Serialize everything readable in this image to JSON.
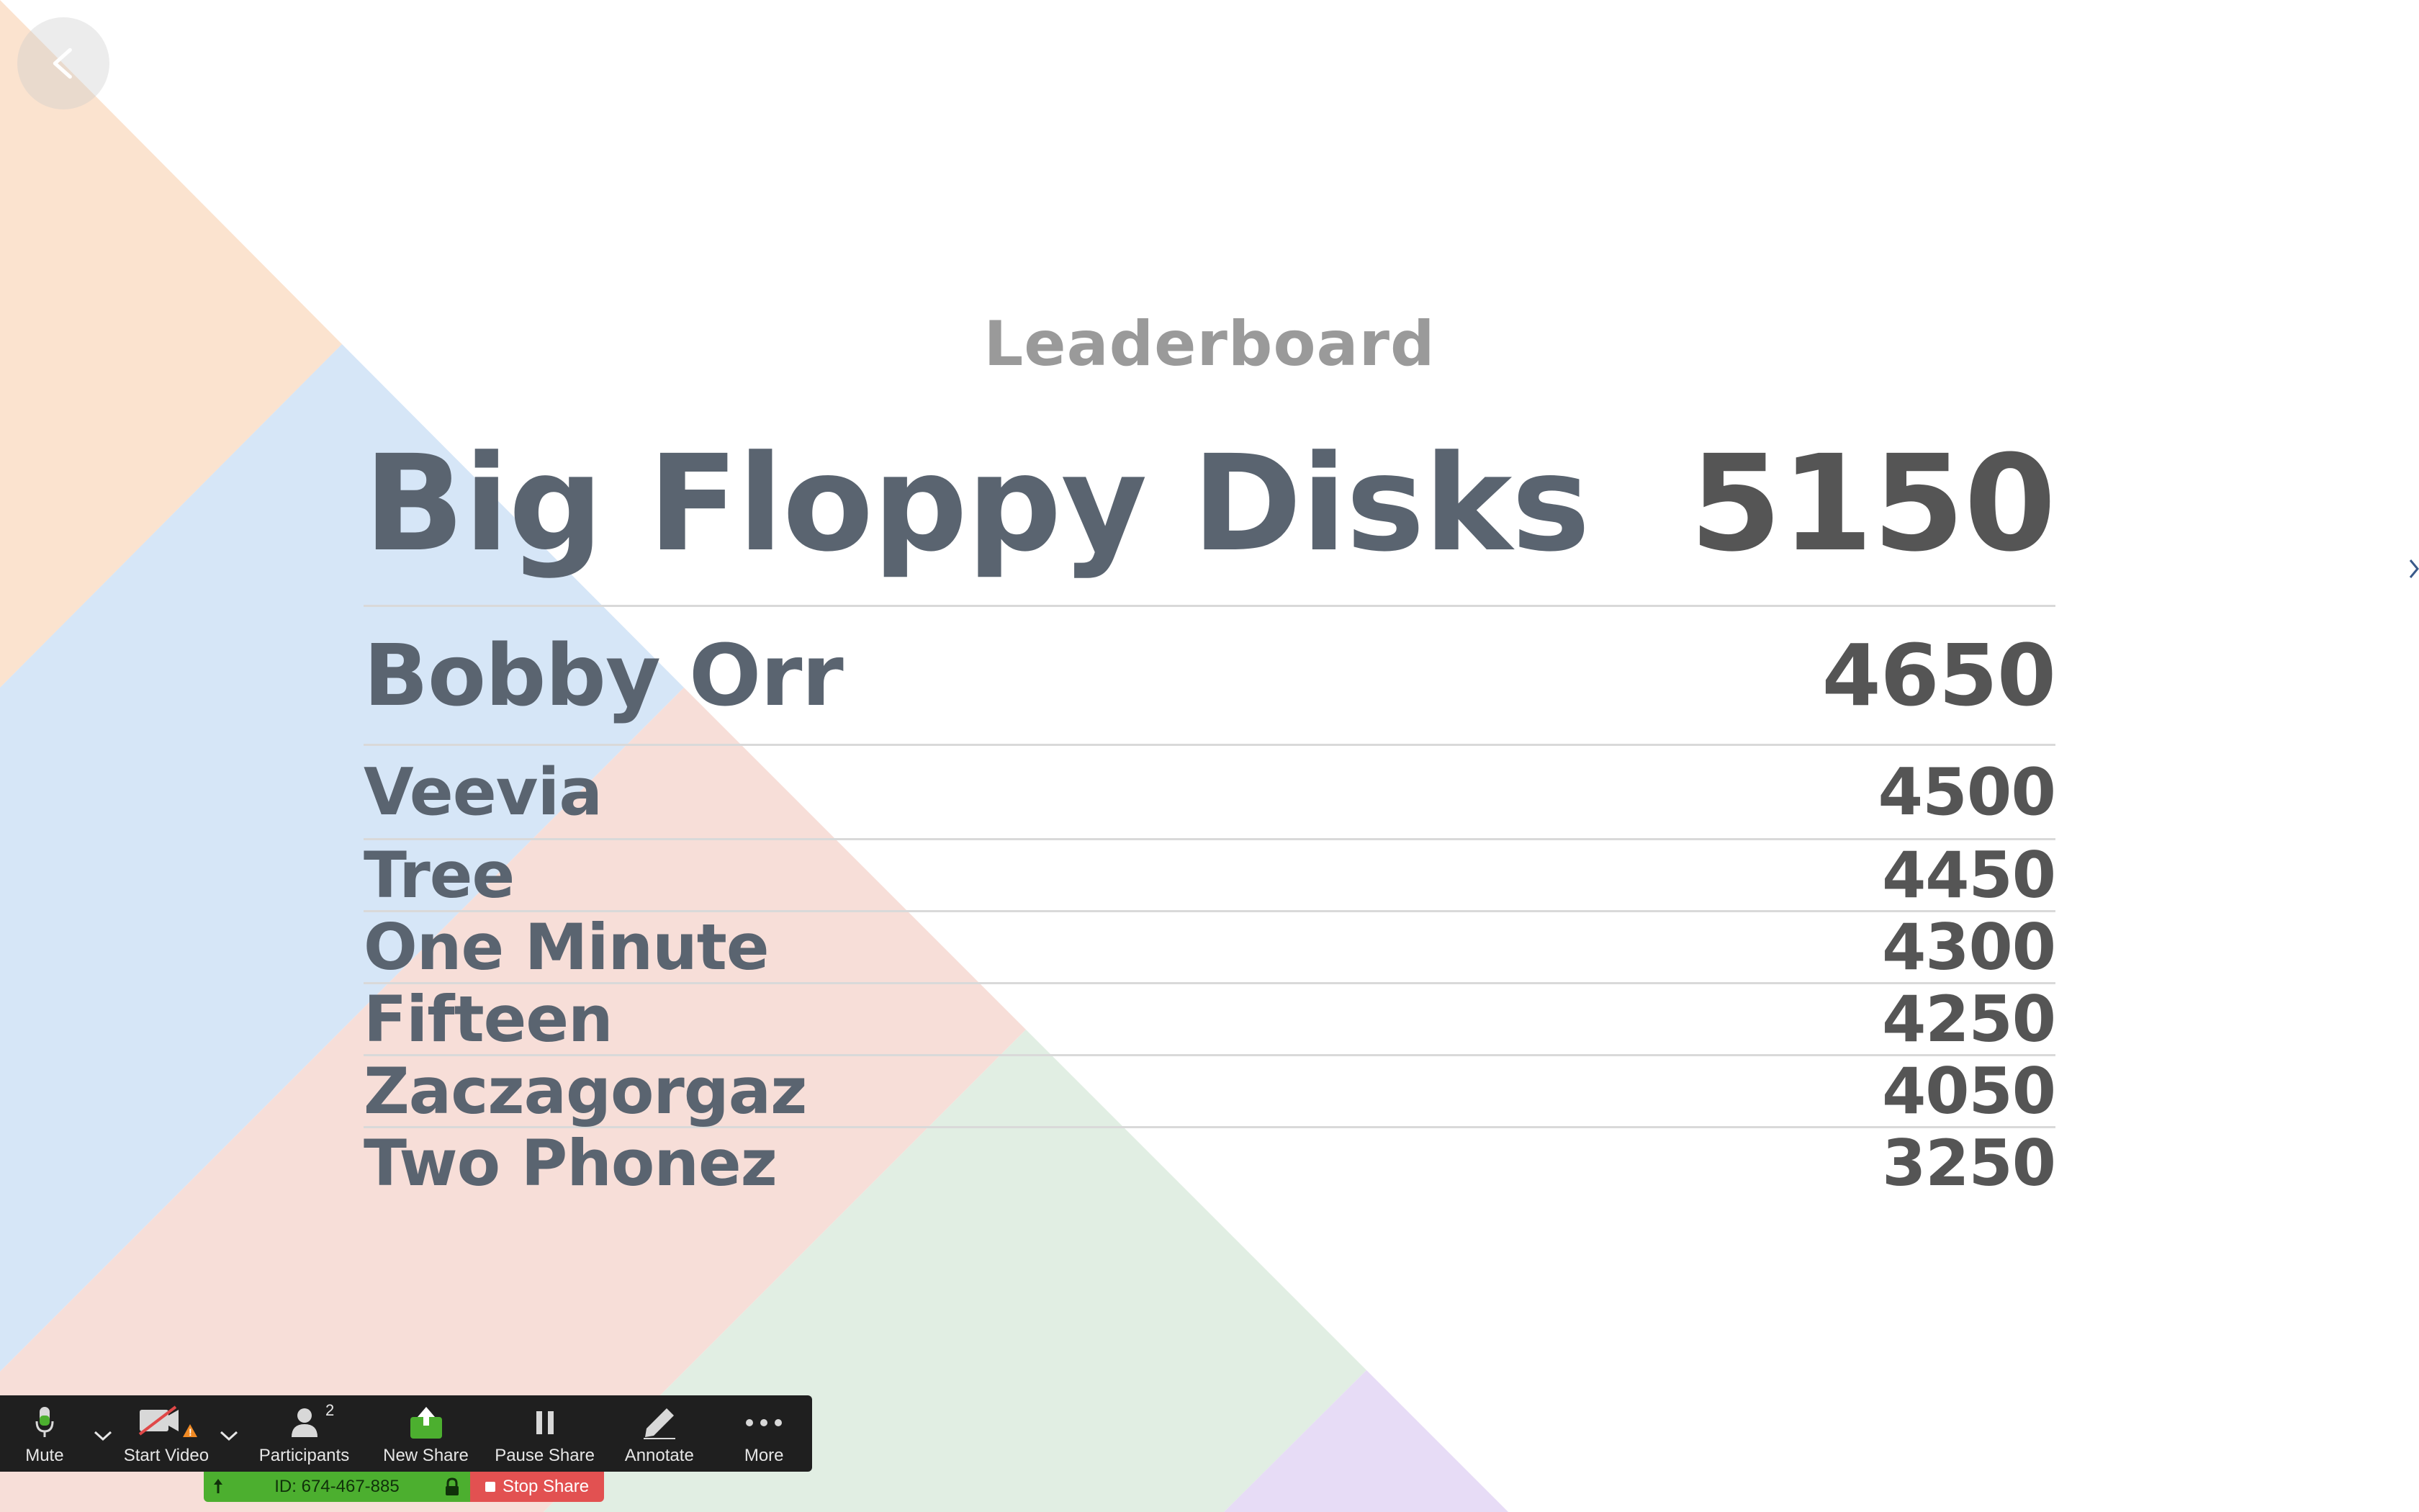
{
  "slide": {
    "title": "Leaderboard",
    "rows": [
      {
        "name": "Big Floppy Disks",
        "score": "5150"
      },
      {
        "name": "Bobby Orr",
        "score": "4650"
      },
      {
        "name": "Veevia",
        "score": "4500"
      },
      {
        "name": "Tree",
        "score": "4450"
      },
      {
        "name": "One Minute",
        "score": "4300"
      },
      {
        "name": "Fifteen",
        "score": "4250"
      },
      {
        "name": "Zaczagorgaz",
        "score": "4050"
      },
      {
        "name": "Two Phonez",
        "score": "3250"
      }
    ]
  },
  "toolbar": {
    "mute_label": "Mute",
    "video_label": "Start Video",
    "participants_label": "Participants",
    "participants_count": "2",
    "new_share_label": "New Share",
    "pause_share_label": "Pause Share",
    "annotate_label": "Annotate",
    "more_label": "More"
  },
  "meeting": {
    "id": "ID: 674-467-885",
    "stop_share_label": "Stop Share"
  },
  "colors": {
    "peach": "#fbe3cf",
    "blue": "#d6e6f7",
    "pink": "#f7ded8",
    "green": "#e1eee3",
    "lavender": "#e7dcf6",
    "share_green": "#4caf2f",
    "stop_red": "#e25151"
  }
}
